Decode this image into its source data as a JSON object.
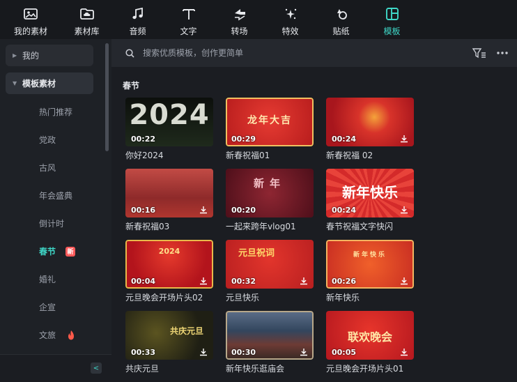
{
  "toolbar": {
    "items": [
      {
        "label": "我的素材",
        "icon": "image-folder-icon"
      },
      {
        "label": "素材库",
        "icon": "cloud-folder-icon"
      },
      {
        "label": "音频",
        "icon": "music-note-icon"
      },
      {
        "label": "文字",
        "icon": "text-t-icon"
      },
      {
        "label": "转场",
        "icon": "transition-arrows-icon"
      },
      {
        "label": "特效",
        "icon": "sparkle-effects-icon"
      },
      {
        "label": "贴纸",
        "icon": "sticker-icon"
      },
      {
        "label": "模板",
        "icon": "template-grid-icon"
      }
    ],
    "active_label": "模板",
    "accent_color": "#3fd8c8"
  },
  "sidebar": {
    "mine_label": "我的",
    "template_label": "模板素材",
    "subcategories": [
      "热门推荐",
      "党政",
      "古风",
      "年会盛典",
      "倒计时",
      "春节",
      "婚礼",
      "企宣",
      "文旅"
    ],
    "active_sub": "春节",
    "new_badge": "新",
    "collapse_icon": "chevron-left-icon"
  },
  "search": {
    "placeholder": "搜索优质模板，创作更简单",
    "filter_icon": "filter-icon",
    "more_icon": "more-dots-icon"
  },
  "section": {
    "title": "春节"
  },
  "templates": [
    {
      "caption": "你好2024",
      "duration": "00:22",
      "thumb_text": "2024",
      "download": false
    },
    {
      "caption": "新春祝福01",
      "duration": "00:29",
      "thumb_text": "龙年大吉",
      "download": false
    },
    {
      "caption": "新春祝福 02",
      "duration": "00:24",
      "thumb_text": "",
      "download": true
    },
    {
      "caption": "新春祝福03",
      "duration": "00:16",
      "thumb_text": "",
      "download": true
    },
    {
      "caption": "一起来跨年vlog01",
      "duration": "00:20",
      "thumb_text": "新年",
      "download": false
    },
    {
      "caption": "春节祝福文字快闪",
      "duration": "00:24",
      "thumb_text": "新年快乐",
      "download": true
    },
    {
      "caption": "元旦晚会开场片头02",
      "duration": "00:04",
      "thumb_text": "2024",
      "download": true
    },
    {
      "caption": "元旦快乐",
      "duration": "00:32",
      "thumb_text": "元旦祝词",
      "download": true
    },
    {
      "caption": "新年快乐",
      "duration": "00:26",
      "thumb_text": "新年快乐",
      "download": true
    },
    {
      "caption": "共庆元旦",
      "duration": "00:33",
      "thumb_text": "共庆元旦",
      "download": true
    },
    {
      "caption": "新年快乐逛庙会",
      "duration": "00:30",
      "thumb_text": "",
      "download": true
    },
    {
      "caption": "元旦晚会开场片头01",
      "duration": "00:05",
      "thumb_text": "联欢晚会",
      "download": true
    }
  ]
}
